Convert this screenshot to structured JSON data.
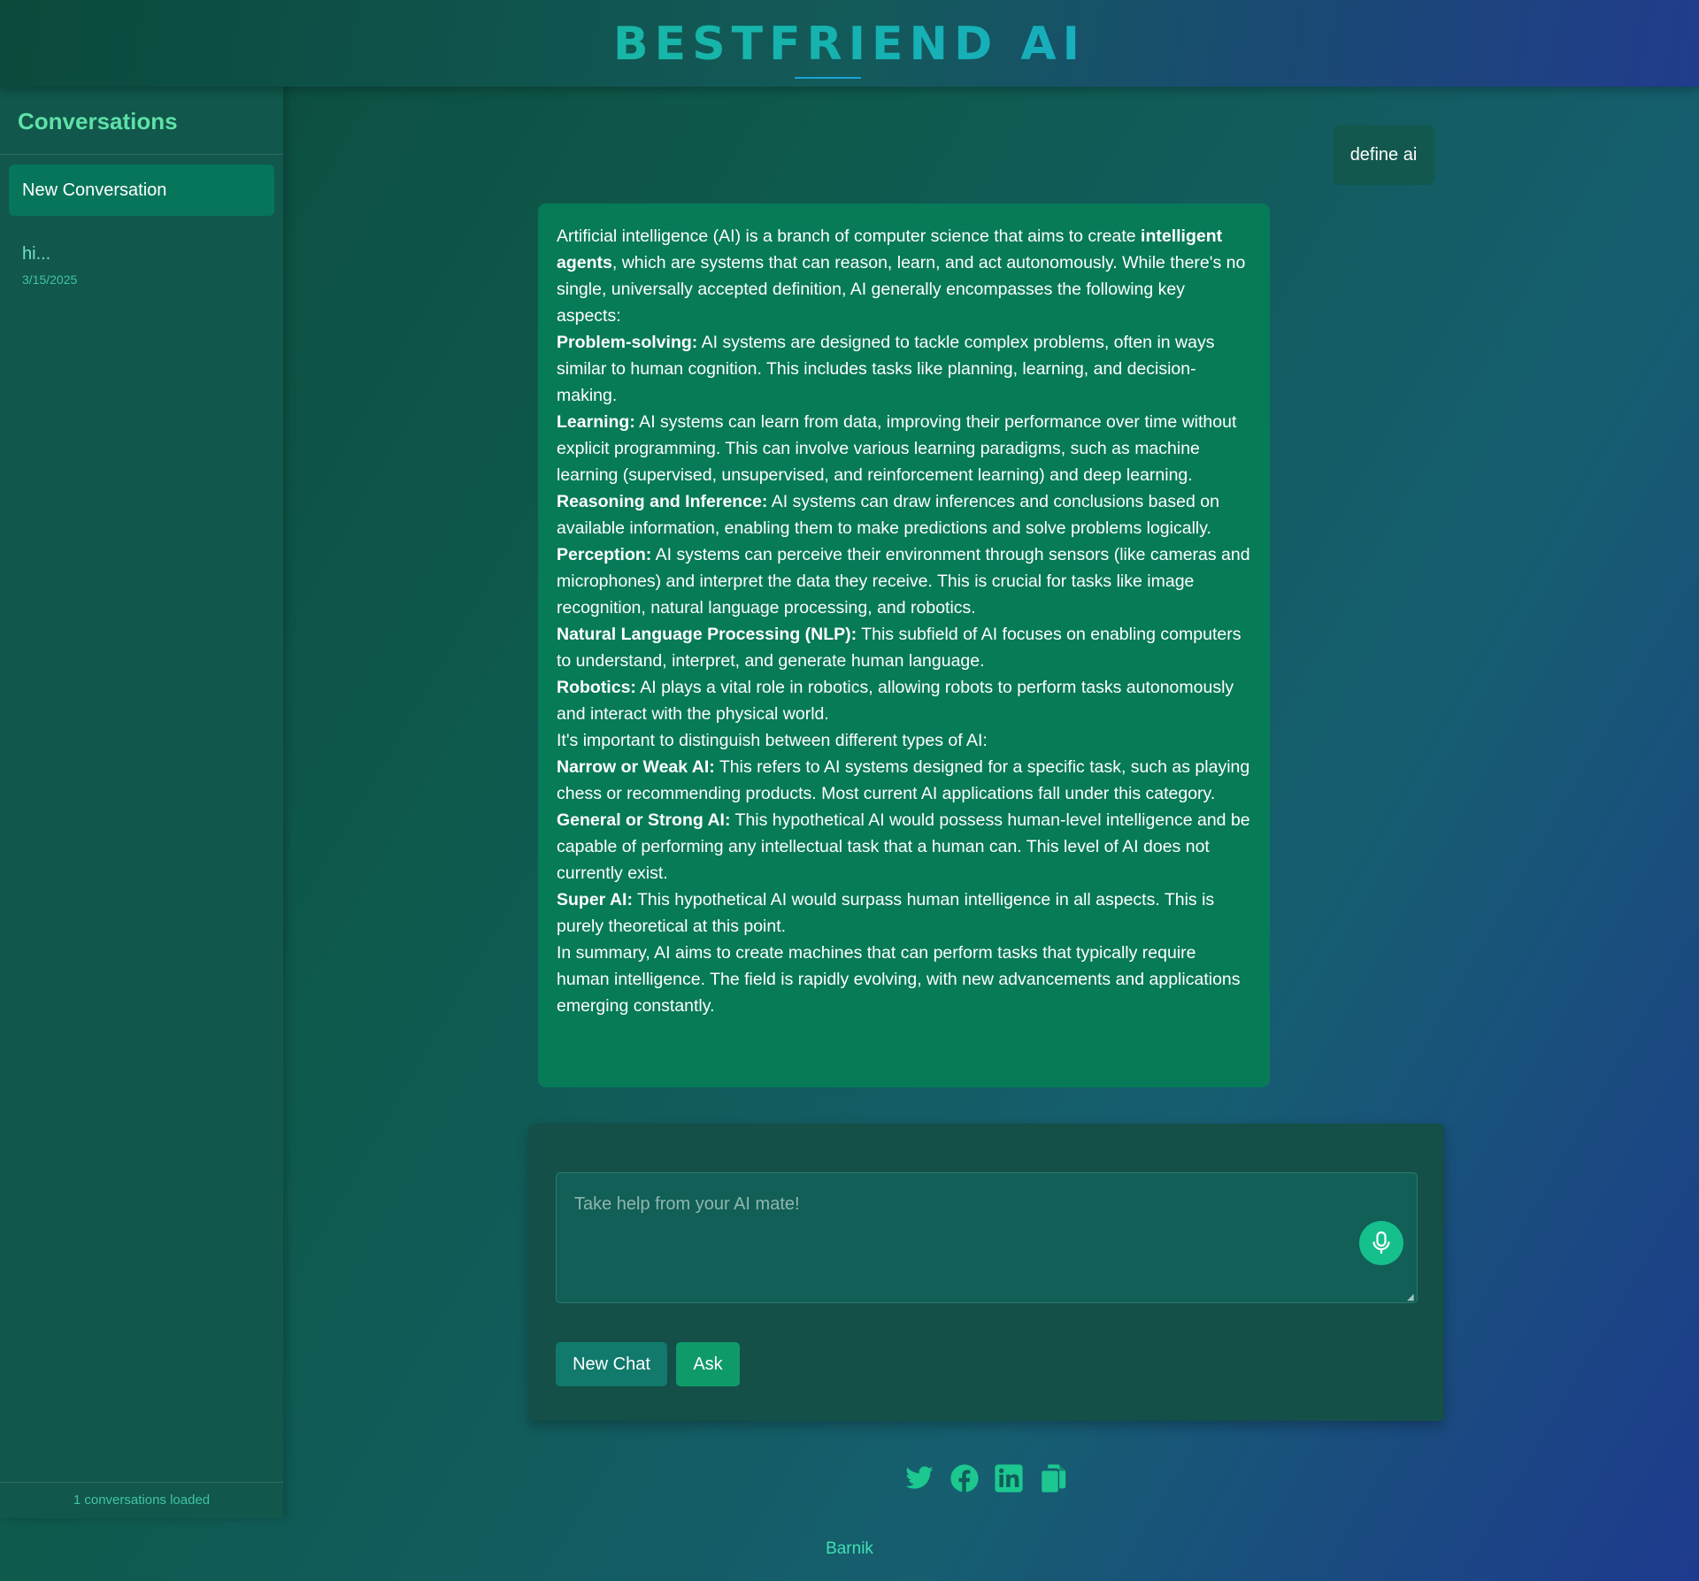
{
  "header": {
    "brand": "BESTFRIEND AI"
  },
  "sidebar": {
    "title": "Conversations",
    "new_conversation_label": "New Conversation",
    "conversations": [
      {
        "title": "hi...",
        "date": "3/15/2025"
      }
    ],
    "footer_status": "1 conversations loaded"
  },
  "chat": {
    "user_message": "define ai",
    "ai_response": {
      "intro_prefix": "Artificial intelligence (AI) is a branch of computer science that aims to create ",
      "intro_bold": "intelligent agents",
      "intro_suffix": ", which are systems that can reason, learn, and act autonomously. While there's no single, universally accepted definition, AI generally encompasses the following key aspects:",
      "aspects": [
        {
          "term": "Problem-solving:",
          "text": " AI systems are designed to tackle complex problems, often in ways similar to human cognition. This includes tasks like planning, learning, and decision-making."
        },
        {
          "term": "Learning:",
          "text": " AI systems can learn from data, improving their performance over time without explicit programming. This can involve various learning paradigms, such as machine learning (supervised, unsupervised, and reinforcement learning) and deep learning."
        },
        {
          "term": "Reasoning and Inference:",
          "text": " AI systems can draw inferences and conclusions based on available information, enabling them to make predictions and solve problems logically."
        },
        {
          "term": "Perception:",
          "text": " AI systems can perceive their environment through sensors (like cameras and microphones) and interpret the data they receive. This is crucial for tasks like image recognition, natural language processing, and robotics."
        },
        {
          "term": "Natural Language Processing (NLP):",
          "text": " This subfield of AI focuses on enabling computers to understand, interpret, and generate human language."
        },
        {
          "term": "Robotics:",
          "text": " AI plays a vital role in robotics, allowing robots to perform tasks autonomously and interact with the physical world."
        }
      ],
      "types_intro": "It's important to distinguish between different types of AI:",
      "types": [
        {
          "term": "Narrow or Weak AI:",
          "text": " This refers to AI systems designed for a specific task, such as playing chess or recommending products. Most current AI applications fall under this category."
        },
        {
          "term": "General or Strong AI:",
          "text": " This hypothetical AI would possess human-level intelligence and be capable of performing any intellectual task that a human can. This level of AI does not currently exist."
        },
        {
          "term": "Super AI:",
          "text": " This hypothetical AI would surpass human intelligence in all aspects. This is purely theoretical at this point."
        }
      ],
      "summary": "In summary, AI aims to create machines that can perform tasks that typically require human intelligence. The field is rapidly evolving, with new advancements and applications emerging constantly."
    }
  },
  "input": {
    "placeholder": "Take help from your AI mate!",
    "value": "",
    "new_chat_label": "New Chat",
    "ask_label": "Ask"
  },
  "social": {
    "icons": [
      "twitter-icon",
      "facebook-icon",
      "linkedin-icon",
      "copy-icon"
    ]
  },
  "footer": {
    "author": "Barnik"
  },
  "colors": {
    "accent": "#15c08c",
    "ai_bubble": "#077a58",
    "user_bubble": "#13584e",
    "sidebar_active": "#07755a"
  }
}
